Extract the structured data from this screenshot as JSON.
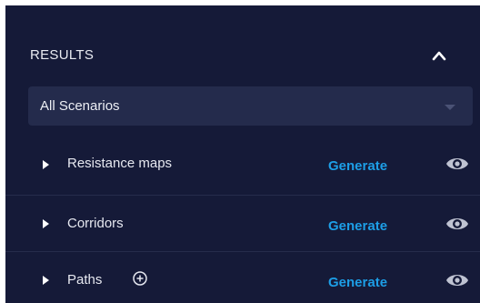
{
  "results": {
    "title": "RESULTS",
    "collapse_icon": "chevron-up-icon",
    "scenario_select": {
      "selected": "All Scenarios",
      "caret_icon": "caret-down-icon"
    },
    "items": [
      {
        "label": "Resistance maps",
        "action": "Generate",
        "has_add": false,
        "visibility_icon": "eye-icon"
      },
      {
        "label": "Corridors",
        "action": "Generate",
        "has_add": false,
        "visibility_icon": "eye-icon"
      },
      {
        "label": "Paths",
        "action": "Generate",
        "has_add": true,
        "visibility_icon": "eye-icon"
      }
    ]
  },
  "colors": {
    "panel_bg": "#151a38",
    "select_bg": "#242b4c",
    "text": "#e9ebf2",
    "accent": "#1d9ee6",
    "icon": "#bfc3d2"
  }
}
